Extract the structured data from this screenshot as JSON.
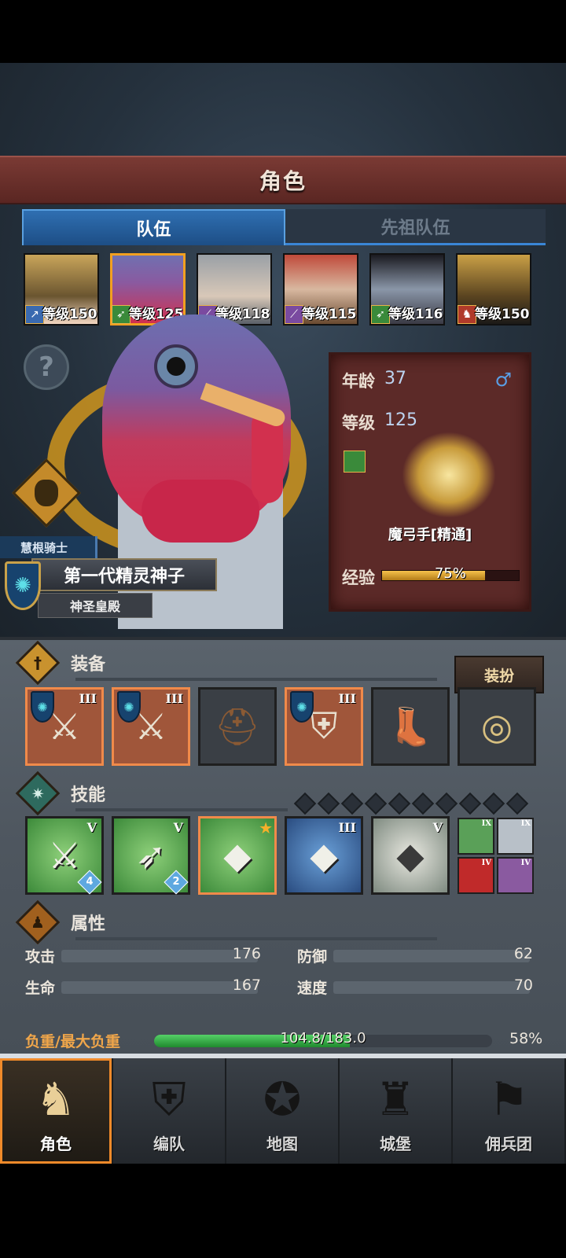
{
  "header": {
    "title": "角色"
  },
  "tabs": [
    {
      "label": "队伍",
      "active": true
    },
    {
      "label": "先祖队伍",
      "active": false
    }
  ],
  "roster": [
    {
      "level_text": "等级150",
      "class_icon": "spear-icon",
      "class_color": "#3a6ab0"
    },
    {
      "level_text": "等级125",
      "class_icon": "bow-icon",
      "class_color": "#3a8a3a",
      "selected": true
    },
    {
      "level_text": "等级118",
      "class_icon": "staff-icon",
      "class_color": "#7a4aa0"
    },
    {
      "level_text": "等级115",
      "class_icon": "staff-icon",
      "class_color": "#7a4aa0"
    },
    {
      "level_text": "等级116",
      "class_icon": "bow-icon",
      "class_color": "#3a8a3a"
    },
    {
      "level_text": "等级150",
      "class_icon": "horse-icon",
      "class_color": "#b03a2a"
    }
  ],
  "character": {
    "age_label": "年龄",
    "age_value": "37",
    "level_label": "等级",
    "level_value": "125",
    "job": "魔弓手[精通]",
    "exp_label": "经验",
    "exp_pct_text": "75%",
    "exp_fraction": 0.75,
    "order": "慧根骑士",
    "title": "第一代精灵神子",
    "faction": "神圣皇殿"
  },
  "equipment": {
    "section_title": "装备",
    "dress_button": "装扮",
    "slots": [
      {
        "name": "weapon-1",
        "tier": "III",
        "icon": "sword-icon"
      },
      {
        "name": "weapon-2",
        "tier": "III",
        "icon": "sword-icon"
      },
      {
        "name": "helmet",
        "tier": "",
        "icon": "helmet-icon"
      },
      {
        "name": "armor",
        "tier": "III",
        "icon": "armor-icon"
      },
      {
        "name": "boots",
        "tier": "",
        "icon": "boots-icon"
      },
      {
        "name": "accessory",
        "tier": "",
        "icon": "medallion-icon"
      }
    ]
  },
  "skills": {
    "section_title": "技能",
    "main": [
      {
        "tier": "V",
        "badge": "4"
      },
      {
        "tier": "V",
        "badge": "2"
      },
      {
        "tier": "",
        "badge": ""
      },
      {
        "tier": "III",
        "badge": ""
      },
      {
        "tier": "V",
        "badge": ""
      }
    ],
    "mini": [
      {
        "tier": "IX"
      },
      {
        "tier": "IX"
      },
      {
        "tier": "IV"
      },
      {
        "tier": "IV"
      }
    ]
  },
  "attributes": {
    "section_title": "属性",
    "attack_label": "攻击",
    "attack_value": "176",
    "defense_label": "防御",
    "defense_value": "62",
    "hp_label": "生命",
    "hp_value": "167",
    "speed_label": "速度",
    "speed_value": "70",
    "load_label": "负重/最大负重",
    "load_text": "104.8/183.0",
    "load_pct": "58%",
    "load_fraction": 0.58
  },
  "nav": [
    {
      "label": "角色",
      "active": true
    },
    {
      "label": "编队"
    },
    {
      "label": "地图"
    },
    {
      "label": "城堡"
    },
    {
      "label": "佣兵团"
    }
  ],
  "colors": {
    "accent": "#f08a2a",
    "tab_blue": "#2f6fb2",
    "panel_red": "#5c2a28"
  }
}
